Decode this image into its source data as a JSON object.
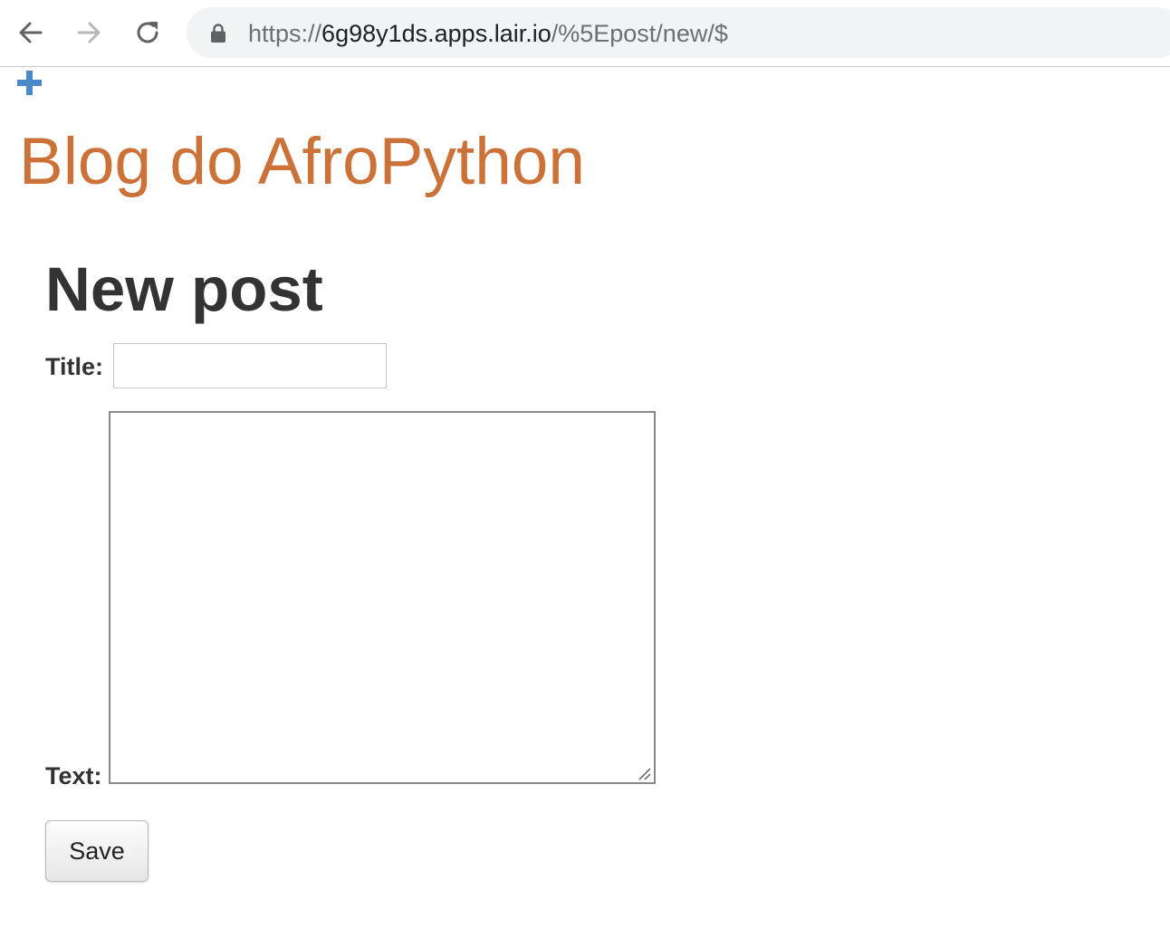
{
  "browser": {
    "url_scheme": "https://",
    "url_host": "6g98y1ds.apps.lair.io",
    "url_path": "/%5Epost/new/$"
  },
  "site": {
    "add_icon": "plus-icon",
    "blog_title": "Blog do AfroPython",
    "colors": {
      "blog_title": "#cc7138",
      "add_icon": "#4a89c8",
      "heading": "#333333"
    }
  },
  "form": {
    "heading": "New post",
    "title_label": "Title:",
    "title_value": "",
    "text_label": "Text:",
    "text_value": "",
    "save_label": "Save"
  }
}
